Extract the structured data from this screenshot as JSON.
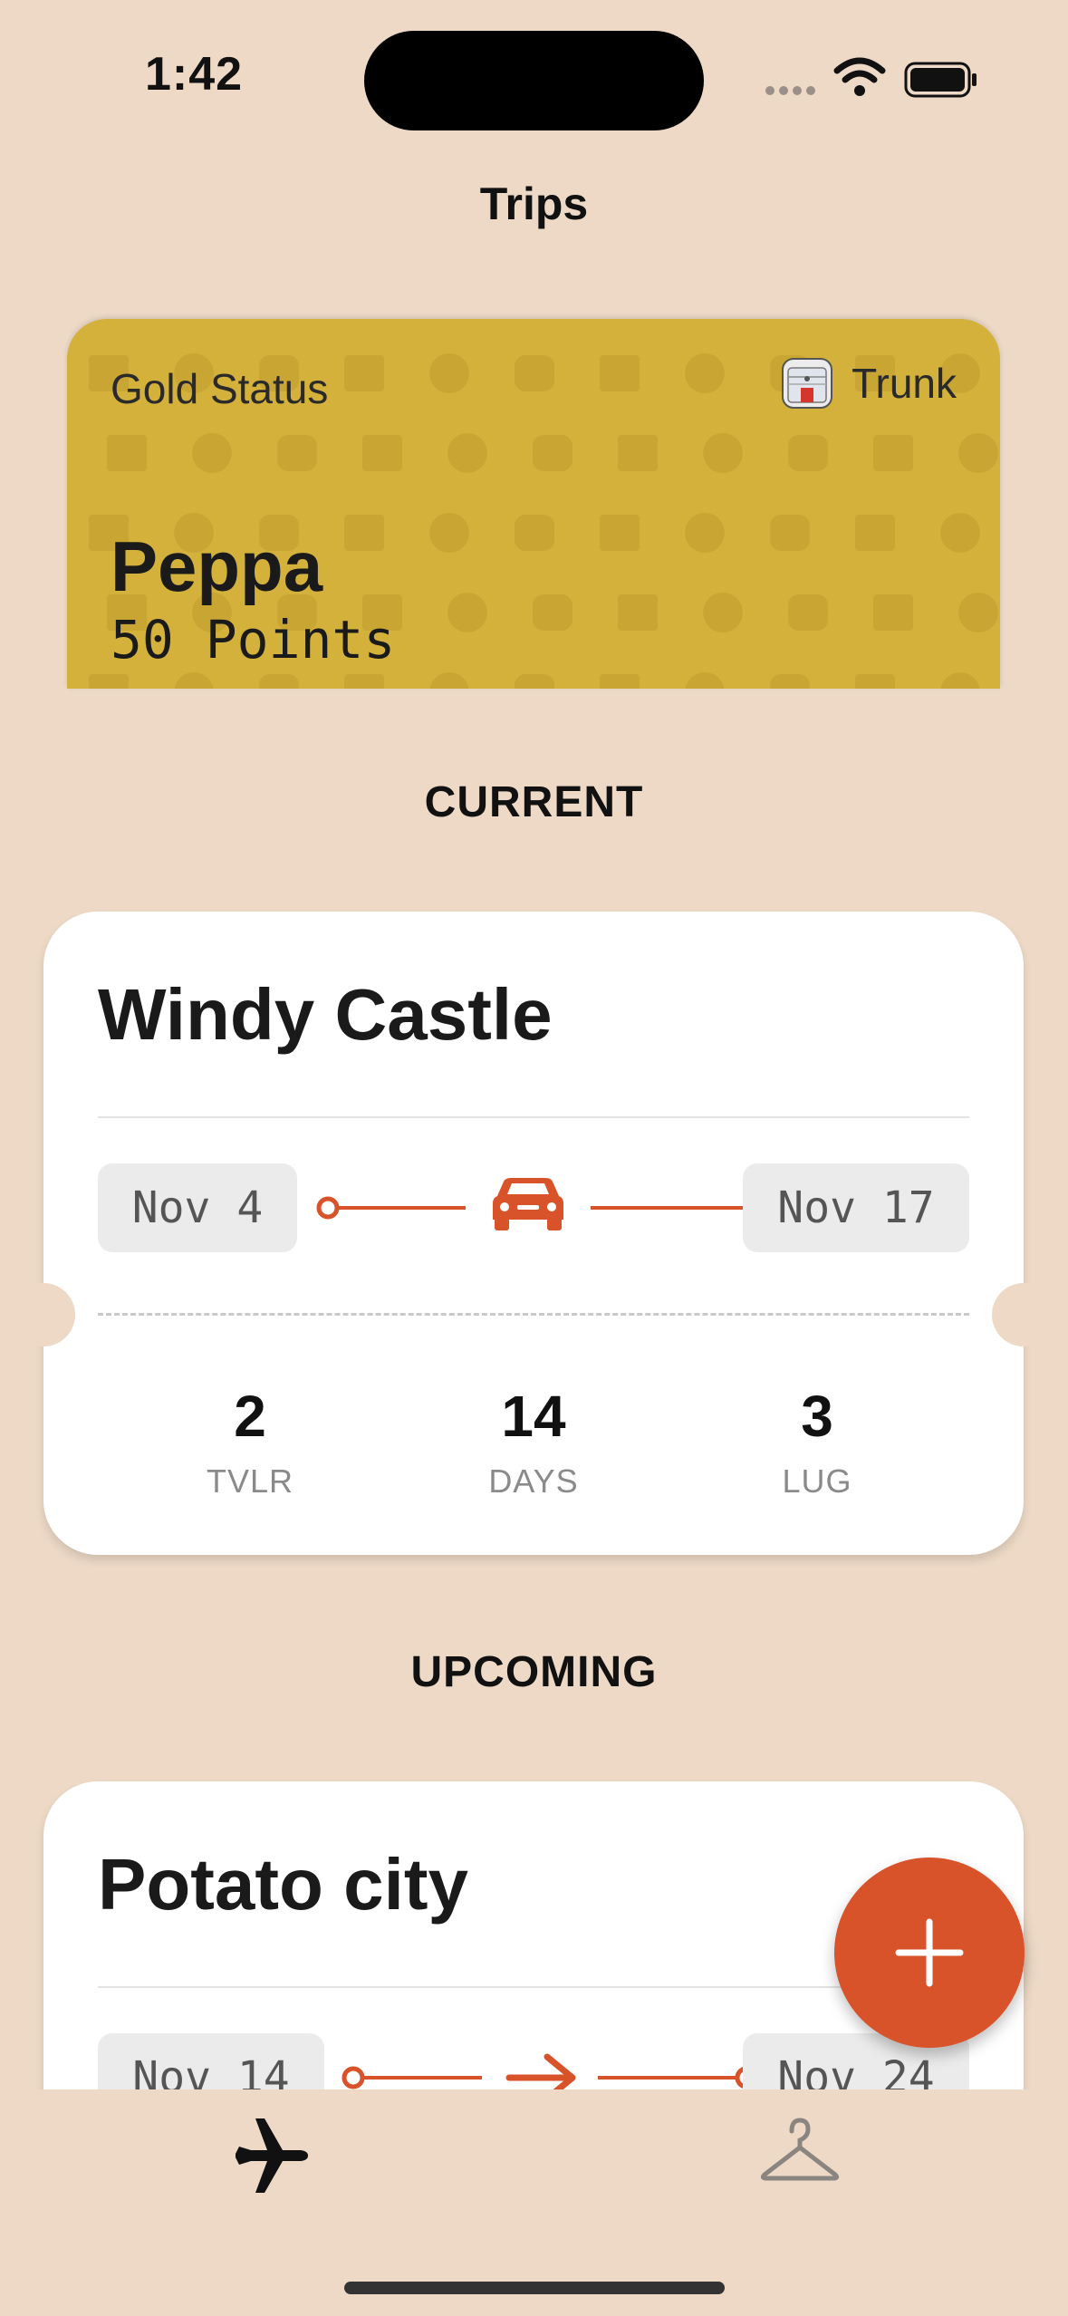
{
  "status_bar": {
    "time": "1:42"
  },
  "header": {
    "title": "Trips"
  },
  "loyalty_card": {
    "status": "Gold Status",
    "brand": "Trunk",
    "member_name": "Peppa",
    "points": "50 Points",
    "color": "#D4B13A"
  },
  "sections": {
    "current": "CURRENT",
    "upcoming": "UPCOMING"
  },
  "current_trip": {
    "title": "Windy Castle",
    "start_date": "Nov 4",
    "end_date": "Nov 17",
    "transport_icon": "car-icon",
    "stats": [
      {
        "value": "2",
        "label": "TVLR"
      },
      {
        "value": "14",
        "label": "DAYS"
      },
      {
        "value": "3",
        "label": "LUG"
      }
    ]
  },
  "upcoming_trip": {
    "title": "Potato city",
    "start_date": "Nov 14",
    "end_date": "Nov 24",
    "transport_icon": "arrow-right-icon"
  },
  "tab_bar": {
    "items": [
      {
        "icon": "airplane-icon",
        "selected": true
      },
      {
        "icon": "hanger-icon",
        "selected": false
      }
    ]
  },
  "colors": {
    "background": "#EDD9C6",
    "accent": "#D8522A",
    "card": "#FFFFFF"
  }
}
